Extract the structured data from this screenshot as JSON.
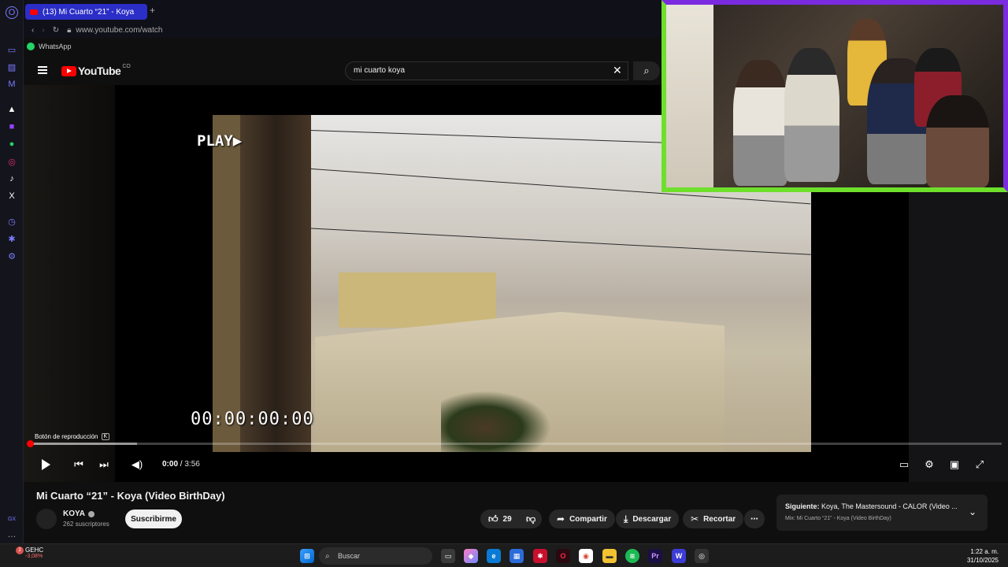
{
  "browser": {
    "tab_title": "(13) Mi Cuarto “21” - Koya",
    "url": "www.youtube.com/watch",
    "bookmark": "WhatsApp"
  },
  "youtube": {
    "logo_text": "YouTube",
    "region": "CO",
    "search_query": "mi cuarto koya"
  },
  "player": {
    "overlay_play_text": "PLAY▶",
    "overlay_timecode": "00:00:00:00",
    "tooltip_label": "Botón de reproducción",
    "tooltip_key": "K",
    "current_time": "0:00",
    "duration": "3:56",
    "progress_fraction": 0.0,
    "buffered_fraction": 0.11
  },
  "video": {
    "title": "Mi Cuarto “21” - Koya (Video BirthDay)",
    "channel": "KOYA",
    "subscribers": "262 suscriptores",
    "subscribe_label": "Suscribirme",
    "likes": "29",
    "share_label": "Compartir",
    "download_label": "Descargar",
    "clip_label": "Recortar"
  },
  "next_up": {
    "prefix": "Siguiente:",
    "title": "Koya, The Mastersound - CALOR (Video ...",
    "mix": "Mix: Mi Cuarto “21” - Koya (Video BirthDay)"
  },
  "taskbar": {
    "stock_name": "GEHC",
    "stock_change": "-3,08%",
    "notif_count": "2",
    "search_label": "Buscar",
    "time": "1:22 a. m.",
    "date": "31/10/2025"
  },
  "colors": {
    "yt_red": "#ff0000",
    "tab_blue": "#2b2ec7",
    "cam_border_green": "#6ee02b",
    "cam_border_purple": "#7a2be0"
  }
}
